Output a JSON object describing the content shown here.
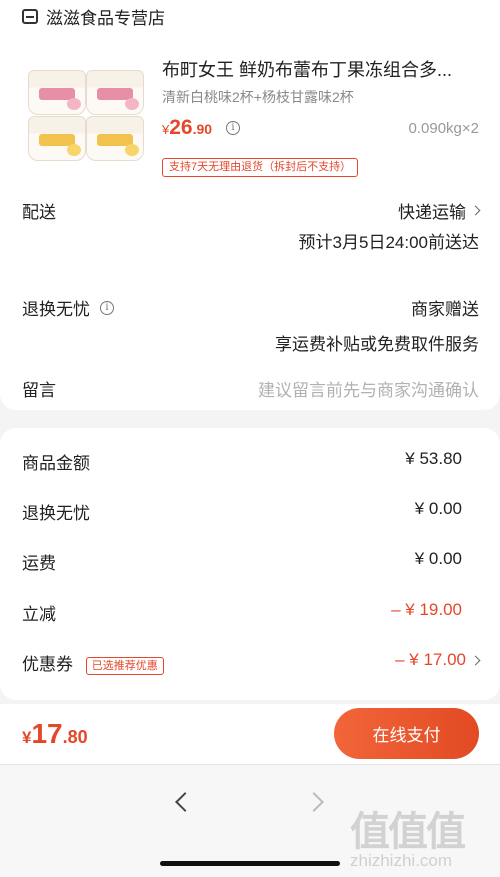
{
  "shop": {
    "name": "滋滋食品专营店",
    "icon": "shop-icon"
  },
  "product": {
    "title": "布町女王 鲜奶布蕾布丁果冻组合多...",
    "spec": "清新白桃味2杯+杨枝甘露味2杯",
    "price_symbol": "¥",
    "price_int": "26",
    "price_dec": ".90",
    "weight": "0.090kg×2",
    "policy": "支持7天无理由退货（拆封后不支持）"
  },
  "delivery": {
    "label": "配送",
    "method": "快递运输",
    "estimate": "预计3月5日24:00前送达"
  },
  "return_service": {
    "label": "退换无忧",
    "provider": "商家赠送",
    "description": "享运费补贴或免费取件服务"
  },
  "message": {
    "label": "留言",
    "placeholder": "建议留言前先与商家沟通确认"
  },
  "summary": {
    "goods_label": "商品金额",
    "goods_value": "¥ 53.80",
    "return_label": "退换无忧",
    "return_value": "¥ 0.00",
    "shipping_label": "运费",
    "shipping_value": "¥ 0.00",
    "discount_label": "立减",
    "discount_value": "– ¥ 19.00",
    "coupon_label": "优惠券",
    "coupon_tag": "已选推荐优惠",
    "coupon_value": "– ¥ 17.00"
  },
  "payment": {
    "symbol": "¥",
    "total_int": "17",
    "total_dec": ".80",
    "button": "在线支付"
  },
  "watermark": {
    "mark": "值值值",
    "url": "zhizhizhi.com"
  },
  "colors": {
    "accent": "#e5472b",
    "background": "#f4f4f4"
  }
}
